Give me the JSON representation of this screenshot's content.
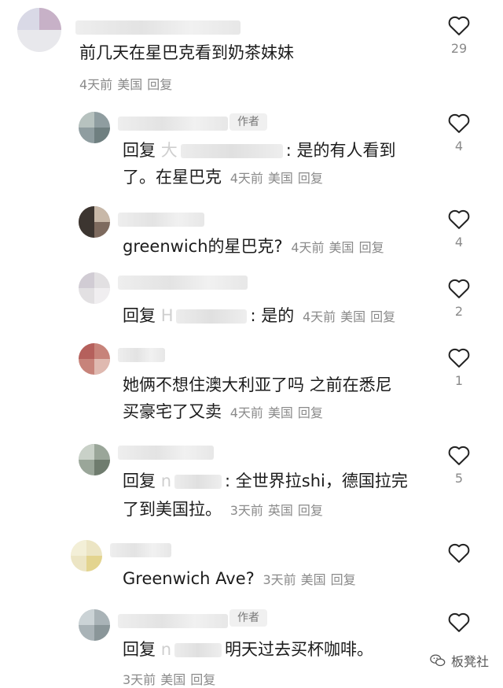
{
  "comments": [
    {
      "text": "前几天在星巴克看到奶茶妹妹",
      "meta": {
        "time": "4天前",
        "region": "美国",
        "reply": "回复"
      },
      "likes": "29"
    },
    {
      "author_badge": "作者",
      "reply_prefix": "回复",
      "reply_to": "大",
      "text": ": 是的有人看到",
      "text2": "了。在星巴克",
      "meta": {
        "time": "4天前",
        "region": "美国",
        "reply": "回复"
      },
      "likes": "4"
    },
    {
      "text": "greenwich的星巴克?",
      "meta": {
        "time": "4天前",
        "region": "美国",
        "reply": "回复"
      },
      "likes": "4"
    },
    {
      "reply_prefix": "回复",
      "reply_to": "H",
      "text": ": 是的",
      "meta": {
        "time": "4天前",
        "region": "美国",
        "reply": "回复"
      },
      "likes": "2"
    },
    {
      "text": "她俩不想住澳大利亚了吗 之前在悉尼",
      "text2": "买豪宅了又卖",
      "meta": {
        "time": "4天前",
        "region": "美国",
        "reply": "回复"
      },
      "likes": "1"
    },
    {
      "reply_prefix": "回复",
      "reply_to": "n",
      "text": ": 全世界拉shi，德国拉完",
      "text2": "了到美国拉。",
      "meta": {
        "time": "3天前",
        "region": "英国",
        "reply": "回复"
      },
      "likes": "5"
    },
    {
      "text": "Greenwich Ave?",
      "meta": {
        "time": "3天前",
        "region": "美国",
        "reply": "回复"
      }
    },
    {
      "author_badge": "作者",
      "reply_prefix": "回复",
      "reply_to": "n",
      "text": "明天过去买杯咖啡。",
      "meta": {
        "time": "3天前",
        "region": "美国",
        "reply": "回复"
      }
    }
  ],
  "watermark": "板凳社",
  "icons": {
    "like": "heart-outline-icon",
    "watermark": "wechat-icon"
  }
}
